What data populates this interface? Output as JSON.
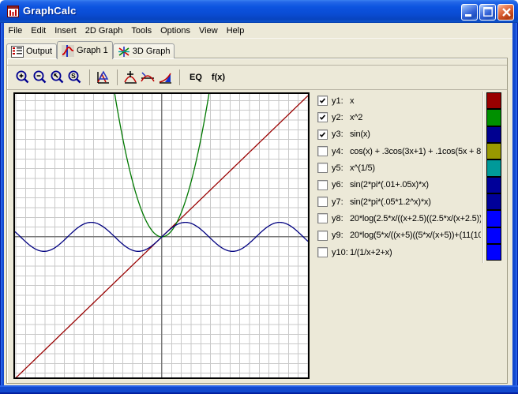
{
  "window": {
    "title": "GraphCalc",
    "controls": [
      "minimize",
      "maximize",
      "close"
    ],
    "titlebar_color": "#0C54E0",
    "border_color": "#1249CE",
    "client_bg": "#ECE9D8"
  },
  "menu": {
    "items": [
      "File",
      "Edit",
      "Insert",
      "2D Graph",
      "Tools",
      "Options",
      "View",
      "Help"
    ]
  },
  "tabs": {
    "items": [
      {
        "label": "Output",
        "icon": "output-icon",
        "selected": false
      },
      {
        "label": "Graph 1",
        "icon": "graph2d-icon",
        "selected": true
      },
      {
        "label": "3D Graph",
        "icon": "graph3d-icon",
        "selected": false
      }
    ]
  },
  "toolbar": {
    "buttons": [
      {
        "name": "zoom-in",
        "type": "icon"
      },
      {
        "name": "zoom-out",
        "type": "icon"
      },
      {
        "name": "zoom-select",
        "type": "icon"
      },
      {
        "name": "zoom-standard",
        "type": "icon"
      },
      {
        "type": "sep"
      },
      {
        "name": "trace",
        "type": "icon"
      },
      {
        "type": "sep"
      },
      {
        "name": "find-maximum",
        "type": "icon"
      },
      {
        "name": "find-root",
        "type": "icon"
      },
      {
        "name": "integrate",
        "type": "icon"
      },
      {
        "type": "sep"
      },
      {
        "name": "equation-list",
        "type": "text",
        "label": "EQ"
      },
      {
        "name": "evaluate",
        "type": "text",
        "label": "f(x)"
      }
    ]
  },
  "equations": [
    {
      "id": "y1",
      "label": "y1:",
      "expr": "x",
      "checked": true,
      "color": "#990000"
    },
    {
      "id": "y2",
      "label": "y2:",
      "expr": "x^2",
      "checked": true,
      "color": "#009000"
    },
    {
      "id": "y3",
      "label": "y3:",
      "expr": "sin(x)",
      "checked": true,
      "color": "#000090"
    },
    {
      "id": "y4",
      "label": "y4:",
      "expr": "cos(x) + .3cos(3x+1) + .1cos(5x + 8)",
      "checked": false,
      "color": "#999900"
    },
    {
      "id": "y5",
      "label": "y5:",
      "expr": "x^(1/5)",
      "checked": false,
      "color": "#009999"
    },
    {
      "id": "y6",
      "label": "y6:",
      "expr": "sin(2*pi*(.01+.05x)*x)",
      "checked": false,
      "color": "#000099"
    },
    {
      "id": "y7",
      "label": "y7:",
      "expr": "sin(2*pi*(.05*1.2^x)*x)",
      "checked": false,
      "color": "#000099"
    },
    {
      "id": "y8",
      "label": "y8:",
      "expr": "20*log(2.5*x/((x+2.5)((2.5*x/(x+2.5))",
      "checked": false,
      "color": "#0000FF"
    },
    {
      "id": "y9",
      "label": "y9:",
      "expr": "20*log(5*x/((x+5)((5*x/(x+5))+(11(10",
      "checked": false,
      "color": "#0000FF"
    },
    {
      "id": "y10",
      "label": "y10:",
      "expr": "1/(1/x+2+x)",
      "checked": false,
      "color": "#0000FF"
    }
  ],
  "chart_data": {
    "type": "line",
    "title": "",
    "x_range": [
      -9.79,
      9.74
    ],
    "y_range": [
      -9.7,
      9.86
    ],
    "grid": true,
    "legend": false,
    "series": [
      {
        "name": "y1",
        "expr": "x",
        "color": "#990000"
      },
      {
        "name": "y2",
        "expr": "x^2",
        "color": "#007800"
      },
      {
        "name": "y3",
        "expr": "sin(x)",
        "color": "#000080"
      }
    ]
  }
}
